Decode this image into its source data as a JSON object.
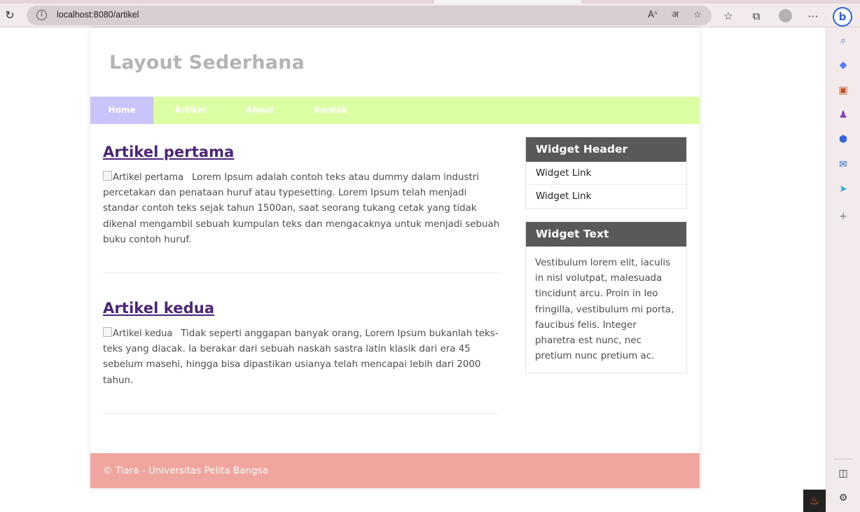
{
  "browser": {
    "url": "localhost:8080/artikel",
    "icons": [
      "info-icon",
      "reload-icon",
      "read-aloud-icon",
      "translate-icon",
      "add-favorite-icon",
      "favorites-icon",
      "collections-icon",
      "profile-icon",
      "more-icon",
      "bing-chat-icon"
    ]
  },
  "sidebar": {
    "icons": [
      "search-icon",
      "shopping-tag-icon",
      "tools-icon",
      "games-icon",
      "microsoft365-icon",
      "outlook-icon",
      "send-icon",
      "add-icon",
      "split-screen-icon",
      "settings-icon"
    ]
  },
  "site": {
    "title": "Layout Sederhana",
    "nav": [
      "Home",
      "Artikel",
      "About",
      "Kontak"
    ],
    "articles": [
      {
        "title": "Artikel pertama",
        "image_alt": "Artikel pertama",
        "body": "Lorem Ipsum adalah contoh teks atau dummy dalam industri percetakan dan penataan huruf atau typesetting. Lorem Ipsum telah menjadi standar contoh teks sejak tahun 1500an, saat seorang tukang cetak yang tidak dikenal mengambil sebuah kumpulan teks dan mengacaknya untuk menjadi sebuah buku contoh huruf."
      },
      {
        "title": "Artikel kedua",
        "image_alt": "Artikel kedua",
        "body": "Tidak seperti anggapan banyak orang, Lorem Ipsum bukanlah teks-teks yang diacak. Ia berakar dari sebuah naskah sastra latin klasik dari era 45 sebelum masehi, hingga bisa dipastikan usianya telah mencapai lebih dari 2000 tahun."
      }
    ],
    "widgets": {
      "header_title": "Widget Header",
      "links": [
        "Widget Link",
        "Widget Link"
      ],
      "text_title": "Widget Text",
      "text_body": "Vestibulum lorem elit, iaculis in nisl volutpat, malesuada tincidunt arcu. Proin in leo fringilla, vestibulum mi porta, faucibus felis. Integer pharetra est nunc, nec pretium nunc pretium ac."
    },
    "footer": "© Tiara - Universitas Pelita Bangsa"
  },
  "colors": {
    "nav_bg": "#ddffa3",
    "nav_active": "#c9c5fb",
    "footer_bg": "#f0a59e",
    "widget_head": "#595959",
    "link": "#4b2577"
  }
}
